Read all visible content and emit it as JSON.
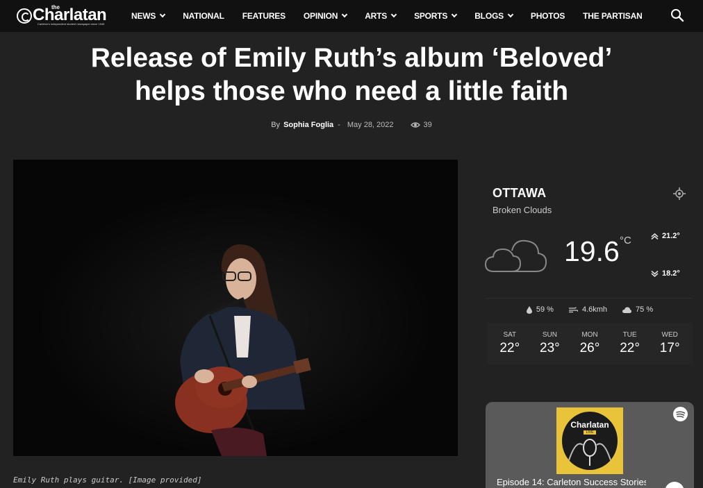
{
  "site": {
    "logo_text": "Charlatan",
    "logo_the": "the",
    "logo_tagline": "Carleton's independent student newspaper since 1945"
  },
  "nav": {
    "items": [
      {
        "label": "NEWS",
        "dropdown": true
      },
      {
        "label": "NATIONAL",
        "dropdown": false
      },
      {
        "label": "FEATURES",
        "dropdown": false
      },
      {
        "label": "OPINION",
        "dropdown": true
      },
      {
        "label": "ARTS",
        "dropdown": true
      },
      {
        "label": "SPORTS",
        "dropdown": true
      },
      {
        "label": "BLOGS",
        "dropdown": true
      },
      {
        "label": "PHOTOS",
        "dropdown": false
      },
      {
        "label": "THE PARTISAN",
        "dropdown": false
      }
    ],
    "search_icon": "search-icon"
  },
  "article": {
    "title_line1": "Release of Emily Ruth’s album ‘Beloved’",
    "title_line2": "helps those who need a little faith",
    "by_label": "By",
    "author": "Sophia Foglia",
    "separator": "-",
    "date": "May 28, 2022",
    "views": "39",
    "caption": "Emily Ruth plays guitar. [Image provided]"
  },
  "weather": {
    "city": "OTTAWA",
    "description": "Broken Clouds",
    "temperature": "19.6",
    "unit": "°C",
    "high": "21.2",
    "low": "18.2",
    "degree_mark": "°",
    "humidity": "59 %",
    "wind": "4.6kmh",
    "clouds": "75 %",
    "forecast": [
      {
        "day": "SAT",
        "temp": "22"
      },
      {
        "day": "SUN",
        "temp": "23"
      },
      {
        "day": "MON",
        "temp": "26"
      },
      {
        "day": "TUE",
        "temp": "22"
      },
      {
        "day": "WED",
        "temp": "17"
      }
    ]
  },
  "podcast": {
    "art_logo": "Charlatan",
    "art_badge": "LIVE",
    "episode_title": "Episode 14: Carleton Success Stories"
  },
  "colors": {
    "page_bg": "#222222",
    "topbar_bg": "#111111",
    "spotify_card_bg": "#5a5a5a",
    "podcast_art_bg": "#e9c43a"
  }
}
